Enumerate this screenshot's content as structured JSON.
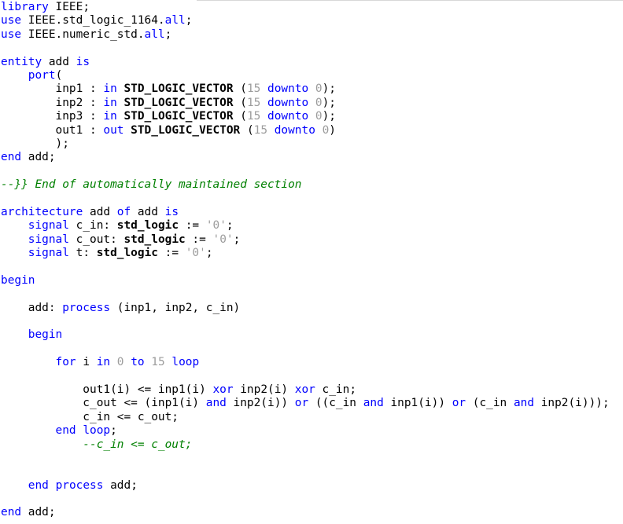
{
  "editor": {
    "language": "VHDL",
    "colors": {
      "background": "#ffffff",
      "text": "#000000",
      "keyword": "#0000ff",
      "literal": "#9c9c9c",
      "comment": "#008000"
    },
    "lines": [
      [
        {
          "t": "library IEEE;",
          "c": "kw:library"
        }
      ],
      [
        {
          "t": "use",
          "c": "kw"
        },
        {
          "t": " IEEE.std_logic_1164."
        },
        {
          "t": "all",
          "c": "kw"
        },
        {
          "t": ";"
        }
      ],
      [
        {
          "t": "use",
          "c": "kw"
        },
        {
          "t": " IEEE.numeric_std."
        },
        {
          "t": "all",
          "c": "kw"
        },
        {
          "t": ";"
        }
      ],
      [],
      [
        {
          "t": "entity",
          "c": "kw"
        },
        {
          "t": " add "
        },
        {
          "t": "is",
          "c": "kw"
        }
      ],
      [
        {
          "t": "    "
        },
        {
          "t": "port",
          "c": "kw"
        },
        {
          "t": "("
        }
      ],
      [
        {
          "t": "        inp1 : "
        },
        {
          "t": "in",
          "c": "kw"
        },
        {
          "t": " "
        },
        {
          "t": "STD_LOGIC_VECTOR",
          "c": "type"
        },
        {
          "t": " ("
        },
        {
          "t": "15",
          "c": "num"
        },
        {
          "t": " "
        },
        {
          "t": "downto",
          "c": "kw"
        },
        {
          "t": " "
        },
        {
          "t": "0",
          "c": "num"
        },
        {
          "t": ");"
        }
      ],
      [
        {
          "t": "        inp2 : "
        },
        {
          "t": "in",
          "c": "kw"
        },
        {
          "t": " "
        },
        {
          "t": "STD_LOGIC_VECTOR",
          "c": "type"
        },
        {
          "t": " ("
        },
        {
          "t": "15",
          "c": "num"
        },
        {
          "t": " "
        },
        {
          "t": "downto",
          "c": "kw"
        },
        {
          "t": " "
        },
        {
          "t": "0",
          "c": "num"
        },
        {
          "t": ");"
        }
      ],
      [
        {
          "t": "        inp3 : "
        },
        {
          "t": "in",
          "c": "kw"
        },
        {
          "t": " "
        },
        {
          "t": "STD_LOGIC_VECTOR",
          "c": "type"
        },
        {
          "t": " ("
        },
        {
          "t": "15",
          "c": "num"
        },
        {
          "t": " "
        },
        {
          "t": "downto",
          "c": "kw"
        },
        {
          "t": " "
        },
        {
          "t": "0",
          "c": "num"
        },
        {
          "t": ");"
        }
      ],
      [
        {
          "t": "        out1 : "
        },
        {
          "t": "out",
          "c": "kw"
        },
        {
          "t": " "
        },
        {
          "t": "STD_LOGIC_VECTOR",
          "c": "type"
        },
        {
          "t": " ("
        },
        {
          "t": "15",
          "c": "num"
        },
        {
          "t": " "
        },
        {
          "t": "downto",
          "c": "kw"
        },
        {
          "t": " "
        },
        {
          "t": "0",
          "c": "num"
        },
        {
          "t": ")"
        }
      ],
      [
        {
          "t": "        );"
        }
      ],
      [
        {
          "t": "end",
          "c": "kw"
        },
        {
          "t": " add;"
        }
      ],
      [],
      [
        {
          "t": "--}} End of automatically maintained section",
          "c": "cmt"
        }
      ],
      [],
      [
        {
          "t": "architecture",
          "c": "kw"
        },
        {
          "t": " add "
        },
        {
          "t": "of",
          "c": "kw"
        },
        {
          "t": " add "
        },
        {
          "t": "is",
          "c": "kw"
        }
      ],
      [
        {
          "t": "    "
        },
        {
          "t": "signal",
          "c": "kw"
        },
        {
          "t": " c_in: "
        },
        {
          "t": "std_logic",
          "c": "type"
        },
        {
          "t": " := "
        },
        {
          "t": "'0'",
          "c": "str"
        },
        {
          "t": ";"
        }
      ],
      [
        {
          "t": "    "
        },
        {
          "t": "signal",
          "c": "kw"
        },
        {
          "t": " c_out: "
        },
        {
          "t": "std_logic",
          "c": "type"
        },
        {
          "t": " := "
        },
        {
          "t": "'0'",
          "c": "str"
        },
        {
          "t": ";"
        }
      ],
      [
        {
          "t": "    "
        },
        {
          "t": "signal",
          "c": "kw"
        },
        {
          "t": " t: "
        },
        {
          "t": "std_logic",
          "c": "type"
        },
        {
          "t": " := "
        },
        {
          "t": "'0'",
          "c": "str"
        },
        {
          "t": ";"
        }
      ],
      [],
      [
        {
          "t": "begin",
          "c": "kw"
        }
      ],
      [],
      [
        {
          "t": "    add: "
        },
        {
          "t": "process",
          "c": "kw"
        },
        {
          "t": " (inp1, inp2, c_in)"
        }
      ],
      [],
      [
        {
          "t": "    "
        },
        {
          "t": "begin",
          "c": "kw"
        }
      ],
      [],
      [
        {
          "t": "        "
        },
        {
          "t": "for",
          "c": "kw"
        },
        {
          "t": " i "
        },
        {
          "t": "in",
          "c": "kw"
        },
        {
          "t": " "
        },
        {
          "t": "0",
          "c": "num"
        },
        {
          "t": " "
        },
        {
          "t": "to",
          "c": "kw"
        },
        {
          "t": " "
        },
        {
          "t": "15",
          "c": "num"
        },
        {
          "t": " "
        },
        {
          "t": "loop",
          "c": "kw"
        }
      ],
      [],
      [
        {
          "t": "            out1(i) <= inp1(i) "
        },
        {
          "t": "xor",
          "c": "kw"
        },
        {
          "t": " inp2(i) "
        },
        {
          "t": "xor",
          "c": "kw"
        },
        {
          "t": " c_in;"
        }
      ],
      [
        {
          "t": "            c_out <= (inp1(i) "
        },
        {
          "t": "and",
          "c": "kw"
        },
        {
          "t": " inp2(i)) "
        },
        {
          "t": "or",
          "c": "kw"
        },
        {
          "t": " ((c_in "
        },
        {
          "t": "and",
          "c": "kw"
        },
        {
          "t": " inp1(i)) "
        },
        {
          "t": "or",
          "c": "kw"
        },
        {
          "t": " (c_in "
        },
        {
          "t": "and",
          "c": "kw"
        },
        {
          "t": " inp2(i)));"
        }
      ],
      [
        {
          "t": "            c_in <= c_out;"
        }
      ],
      [
        {
          "t": "        "
        },
        {
          "t": "end",
          "c": "kw"
        },
        {
          "t": " "
        },
        {
          "t": "loop",
          "c": "kw"
        },
        {
          "t": ";"
        }
      ],
      [
        {
          "t": "            --c_in <= c_out;",
          "c": "cmt"
        }
      ],
      [],
      [],
      [
        {
          "t": "    "
        },
        {
          "t": "end",
          "c": "kw"
        },
        {
          "t": " "
        },
        {
          "t": "process",
          "c": "kw"
        },
        {
          "t": " add;"
        }
      ],
      [],
      [
        {
          "t": "end",
          "c": "kw"
        },
        {
          "t": " add;"
        }
      ]
    ]
  }
}
